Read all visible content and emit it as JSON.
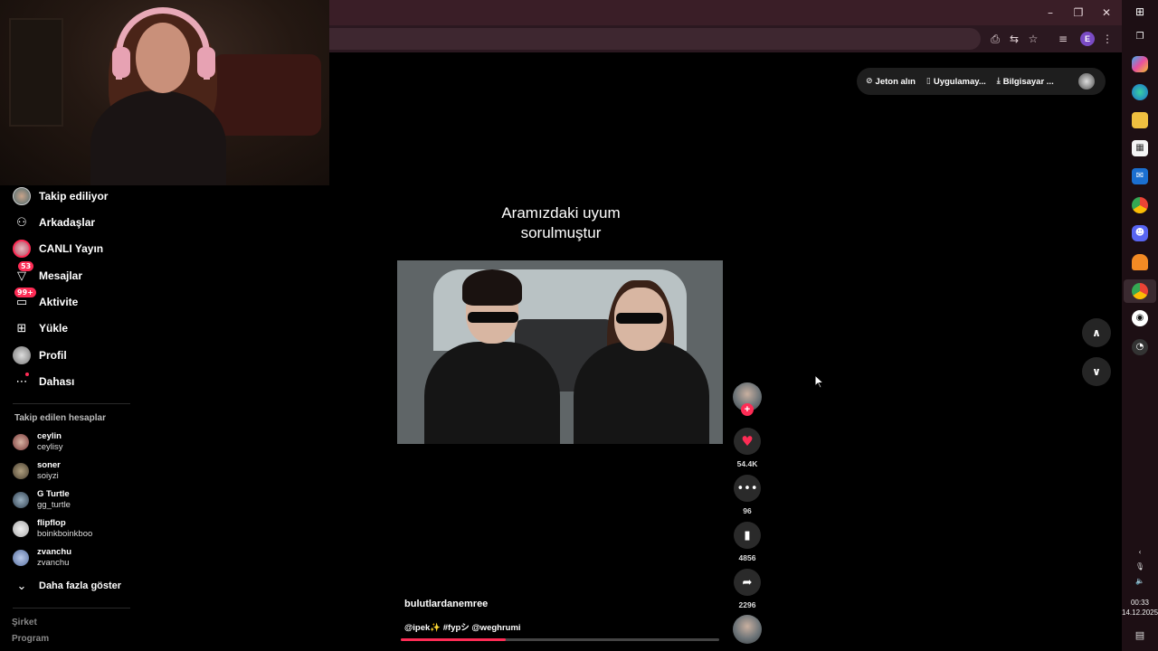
{
  "browser": {
    "window_controls": {
      "minimize": "–",
      "restore": "❐",
      "close": "✕"
    },
    "toolbar_icons": [
      "install-icon",
      "translate-icon",
      "star-icon",
      "playlist-icon",
      "profile-icon",
      "menu-icon"
    ],
    "profile_initial": "E"
  },
  "sidebar": {
    "items": [
      {
        "label": "Takip ediliyor",
        "icon": "following-avatar-icon"
      },
      {
        "label": "Arkadaşlar",
        "icon": "friends-icon"
      },
      {
        "label": "CANLI Yayın",
        "icon": "live-icon"
      },
      {
        "label": "Mesajlar",
        "icon": "messages-icon",
        "badge": "53"
      },
      {
        "label": "Aktivite",
        "icon": "activity-icon",
        "badge": "99+"
      },
      {
        "label": "Yükle",
        "icon": "upload-icon"
      },
      {
        "label": "Profil",
        "icon": "profile-avatar-icon"
      },
      {
        "label": "Dahası",
        "icon": "more-icon"
      }
    ],
    "following_title": "Takip edilen hesaplar",
    "accounts": [
      {
        "name": "ceylin",
        "username": "ceylisy"
      },
      {
        "name": "soner",
        "username": "soiyzi"
      },
      {
        "name": "G Turtle",
        "username": "gg_turtle"
      },
      {
        "name": "flipflop",
        "username": "boinkboinkboo"
      },
      {
        "name": "zvanchu",
        "username": "zvanchu"
      }
    ],
    "show_more": "Daha fazla göster",
    "footer": [
      "Şirket",
      "Program"
    ]
  },
  "top_bar": {
    "coins": "Jeton alın",
    "app": "Uygulamay...",
    "computer": "Bilgisayar ..."
  },
  "video": {
    "caption_line1": "Aramızdaki uyum",
    "caption_line2": "sorulmuştur",
    "author": "bulutlardanemree",
    "description": "@ipek✨ #fypシ @weghrumi",
    "progress": 0.33
  },
  "actions": {
    "likes": "54.4K",
    "comments": "96",
    "saves": "4856",
    "shares": "2296",
    "follow_symbol": "+"
  },
  "nav": {
    "up": "∧",
    "down": "∨"
  },
  "taskbar": {
    "time": "00:33",
    "date": "14.12.2025"
  }
}
